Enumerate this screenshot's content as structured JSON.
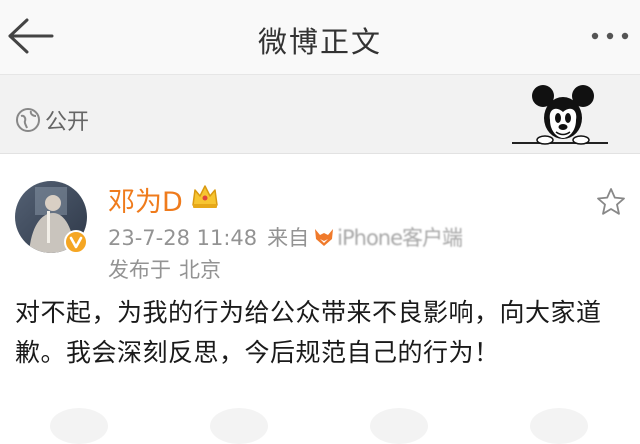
{
  "navbar": {
    "title": "微博正文"
  },
  "visibility": {
    "label": "公开"
  },
  "post": {
    "username": "邓为D",
    "timestamp": "23-7-28 11:48",
    "source_prefix": "来自",
    "source_client": "iPhone客户端",
    "location_prefix": "发布于",
    "location": "北京",
    "text": "对不起，为我的行为给公众带来不良影响，向大家道歉。我会深刻反思，今后规范自己的行为！"
  },
  "colors": {
    "username": "#ef7b1c",
    "meta": "#939393",
    "verify_badge": "#f5a623",
    "nav_bg": "#f9f9f9",
    "visibility_bg": "#f2f2f2"
  },
  "icons": [
    "back-arrow-icon",
    "more-icon",
    "globe-icon",
    "mickey-mouse-icon",
    "crown-icon",
    "star-icon",
    "verified-badge-icon",
    "fox-icon"
  ]
}
